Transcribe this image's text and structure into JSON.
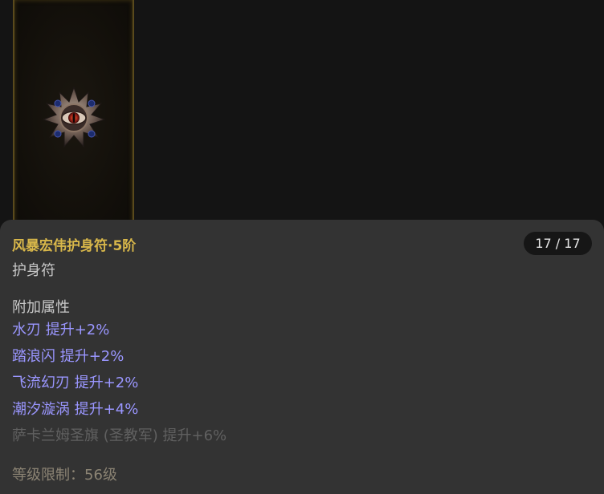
{
  "item": {
    "name": "风暴宏伟护身符·5阶",
    "type": "护身符",
    "count": "17 / 17"
  },
  "attributes": {
    "section_title": "附加属性",
    "lines": [
      {
        "text": "水刃 提升+2%",
        "active": true
      },
      {
        "text": "踏浪闪 提升+2%",
        "active": true
      },
      {
        "text": "飞流幻刃 提升+2%",
        "active": true
      },
      {
        "text": "潮汐漩涡 提升+4%",
        "active": true
      },
      {
        "text": "萨卡兰姆圣旗 (圣教军) 提升+6%",
        "active": false
      }
    ]
  },
  "requirement": {
    "level_text": "等级限制：56级"
  },
  "colors": {
    "name": "#d8b74a",
    "active_attr": "#9a96ff",
    "inactive_attr": "#606060",
    "card_bg": "#333333",
    "page_bg": "#141414"
  },
  "icons": {
    "item_art": "amulet-icon"
  }
}
